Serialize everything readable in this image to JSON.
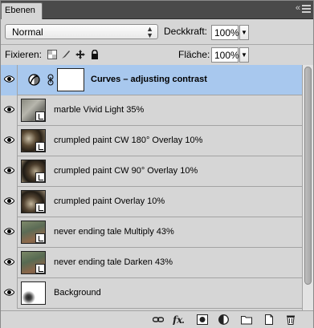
{
  "panel": {
    "tab_title": "Ebenen",
    "close_glyph": "«"
  },
  "options": {
    "blend_mode": "Normal",
    "opacity_label": "Deckkraft:",
    "opacity_value": "100%",
    "lock_label": "Fixieren:",
    "fill_label": "Fläche:",
    "fill_value": "100%"
  },
  "layers": [
    {
      "name": "Curves – adjusting contrast",
      "selected": true,
      "type": "adjustment",
      "icon": "curves-adjustment-icon"
    },
    {
      "name": "marble Vivid Light 35%",
      "type": "smart-object",
      "thumb": "marble"
    },
    {
      "name": "crumpled paint CW 180° Overlay 10%",
      "type": "smart-object",
      "thumb": "crumpled"
    },
    {
      "name": "crumpled paint CW 90° Overlay 10%",
      "type": "smart-object",
      "thumb": "crumpled"
    },
    {
      "name": "crumpled paint Overlay 10%",
      "type": "smart-object",
      "thumb": "crumpled"
    },
    {
      "name": "never ending tale Multiply 43%",
      "type": "smart-object",
      "thumb": "tale"
    },
    {
      "name": "never ending tale Darken 43%",
      "type": "smart-object",
      "thumb": "tale"
    },
    {
      "name": "Background",
      "type": "pixel",
      "thumb": "background"
    }
  ],
  "bottom_icons": [
    "link-layers-icon",
    "fx-icon",
    "add-mask-icon",
    "new-adjustment-icon",
    "new-group-icon",
    "new-layer-icon",
    "trash-icon"
  ],
  "colors": {
    "selection": "#a8c8ee",
    "panel_bg": "#d6d6d6",
    "tab_bar": "#4a4a4a"
  }
}
